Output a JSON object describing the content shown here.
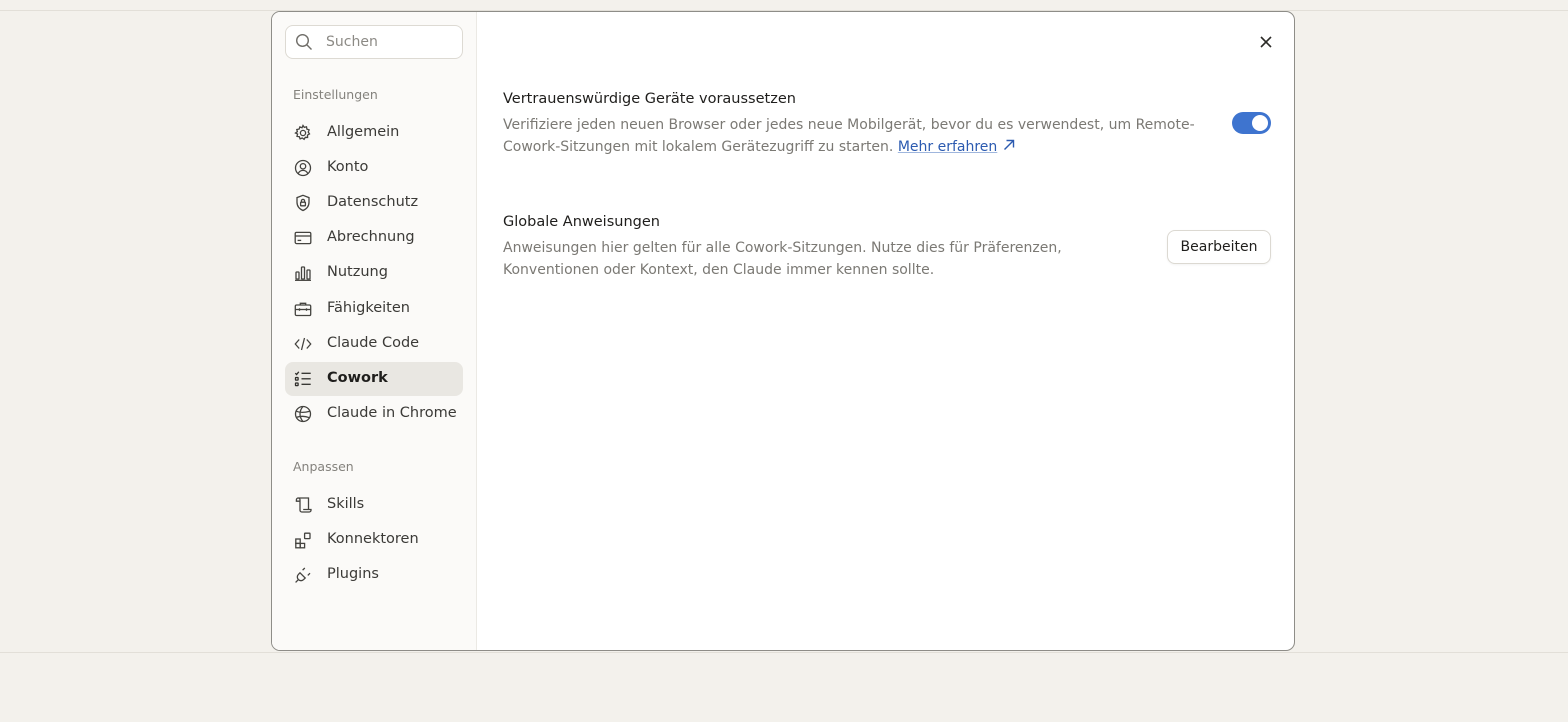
{
  "search": {
    "placeholder": "Suchen"
  },
  "sidebar": {
    "sections": [
      {
        "label": "Einstellungen",
        "items": [
          {
            "label": "Allgemein",
            "icon": "gear-icon"
          },
          {
            "label": "Konto",
            "icon": "user-circle-icon"
          },
          {
            "label": "Datenschutz",
            "icon": "shield-lock-icon"
          },
          {
            "label": "Abrechnung",
            "icon": "credit-card-icon"
          },
          {
            "label": "Nutzung",
            "icon": "bar-chart-icon"
          },
          {
            "label": "Fähigkeiten",
            "icon": "toolbox-icon"
          },
          {
            "label": "Claude Code",
            "icon": "code-icon"
          },
          {
            "label": "Cowork",
            "icon": "checklist-icon",
            "active": true
          },
          {
            "label": "Claude in Chrome",
            "icon": "globe-icon"
          }
        ]
      },
      {
        "label": "Anpassen",
        "items": [
          {
            "label": "Skills",
            "icon": "scroll-icon"
          },
          {
            "label": "Konnektoren",
            "icon": "blocks-icon"
          },
          {
            "label": "Plugins",
            "icon": "plug-icon"
          }
        ]
      }
    ]
  },
  "settings": {
    "trusted_devices": {
      "title": "Vertrauenswürdige Geräte voraussetzen",
      "desc_line1": "Verifiziere jeden neuen Browser oder jedes neue Mobilgerät, bevor du es verwendest, um Remote-",
      "desc_line2": "Cowork-Sitzungen mit lokalem Gerätezugriff zu starten.",
      "link": "Mehr erfahren",
      "toggle_on": true
    },
    "global_instructions": {
      "title": "Globale Anweisungen",
      "desc_line1": "Anweisungen hier gelten für alle Cowork-Sitzungen. Nutze dies für Präferenzen,",
      "desc_line2": "Konventionen oder Kontext, den Claude immer kennen sollte.",
      "button": "Bearbeiten"
    }
  },
  "colors": {
    "accent": "#3e74cf",
    "link": "#2b5ab0",
    "active_item_bg": "#e9e7e2"
  }
}
